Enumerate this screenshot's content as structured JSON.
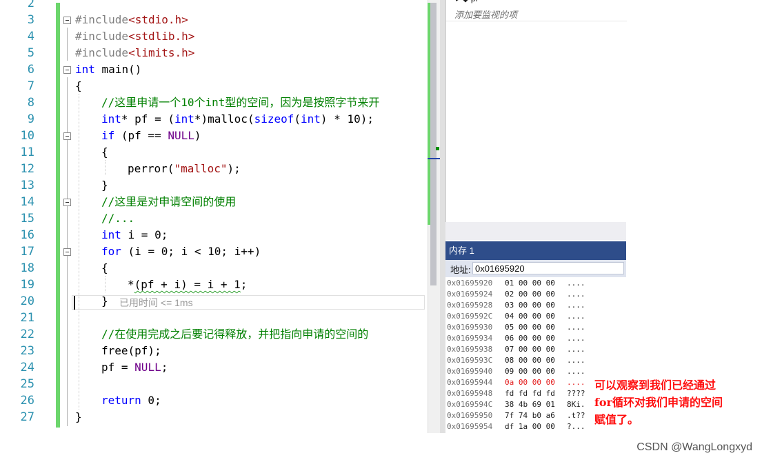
{
  "editor": {
    "lines": [
      {
        "n": "2",
        "indent": 0,
        "tokens": []
      },
      {
        "n": "3",
        "indent": 0,
        "tokens": [
          {
            "t": "#include",
            "c": "inc"
          },
          {
            "t": "<stdio.h>",
            "c": "str"
          }
        ]
      },
      {
        "n": "4",
        "indent": 0,
        "tokens": [
          {
            "t": "#include",
            "c": "inc"
          },
          {
            "t": "<stdlib.h>",
            "c": "str"
          }
        ]
      },
      {
        "n": "5",
        "indent": 0,
        "tokens": [
          {
            "t": "#include",
            "c": "inc"
          },
          {
            "t": "<limits.h>",
            "c": "str"
          }
        ]
      },
      {
        "n": "6",
        "indent": 0,
        "tokens": [
          {
            "t": "int",
            "c": "kw"
          },
          {
            "t": " main()",
            "c": ""
          }
        ]
      },
      {
        "n": "7",
        "indent": 0,
        "tokens": [
          {
            "t": "{",
            "c": ""
          }
        ]
      },
      {
        "n": "8",
        "indent": 1,
        "tokens": [
          {
            "t": "//这里申请一个10个int型的空间，因为是按照字节来开",
            "c": "cm"
          }
        ]
      },
      {
        "n": "9",
        "indent": 1,
        "tokens": [
          {
            "t": "int",
            "c": "kw"
          },
          {
            "t": "* pf = (",
            "c": ""
          },
          {
            "t": "int",
            "c": "kw"
          },
          {
            "t": "*)malloc(",
            "c": ""
          },
          {
            "t": "sizeof",
            "c": "kw"
          },
          {
            "t": "(",
            "c": ""
          },
          {
            "t": "int",
            "c": "kw"
          },
          {
            "t": ") * 10);",
            "c": ""
          }
        ]
      },
      {
        "n": "10",
        "indent": 1,
        "tokens": [
          {
            "t": "if",
            "c": "kw"
          },
          {
            "t": " (pf == ",
            "c": ""
          },
          {
            "t": "NULL",
            "c": "mac"
          },
          {
            "t": ")",
            "c": ""
          }
        ]
      },
      {
        "n": "11",
        "indent": 1,
        "tokens": [
          {
            "t": "{",
            "c": ""
          }
        ]
      },
      {
        "n": "12",
        "indent": 2,
        "tokens": [
          {
            "t": "perror(",
            "c": ""
          },
          {
            "t": "\"malloc\"",
            "c": "str"
          },
          {
            "t": ");",
            "c": ""
          }
        ]
      },
      {
        "n": "13",
        "indent": 1,
        "tokens": [
          {
            "t": "}",
            "c": ""
          }
        ]
      },
      {
        "n": "14",
        "indent": 1,
        "tokens": [
          {
            "t": "//这里是对申请空间的使用",
            "c": "cm"
          }
        ]
      },
      {
        "n": "15",
        "indent": 1,
        "tokens": [
          {
            "t": "//...",
            "c": "cm"
          }
        ]
      },
      {
        "n": "16",
        "indent": 1,
        "tokens": [
          {
            "t": "int",
            "c": "kw"
          },
          {
            "t": " i = 0;",
            "c": ""
          }
        ]
      },
      {
        "n": "17",
        "indent": 1,
        "tokens": [
          {
            "t": "for",
            "c": "kw"
          },
          {
            "t": " (i = 0; i < 10; i++)",
            "c": ""
          }
        ]
      },
      {
        "n": "18",
        "indent": 1,
        "tokens": [
          {
            "t": "{",
            "c": ""
          }
        ]
      },
      {
        "n": "19",
        "indent": 2,
        "tokens": [
          {
            "t": "*",
            "c": ""
          },
          {
            "t": "(pf + i) = i + 1",
            "c": "squig"
          },
          {
            "t": ";",
            "c": ""
          }
        ]
      },
      {
        "n": "20",
        "indent": 1,
        "tokens": [
          {
            "t": "}",
            "c": ""
          }
        ]
      },
      {
        "n": "21",
        "indent": 0,
        "tokens": []
      },
      {
        "n": "22",
        "indent": 1,
        "tokens": [
          {
            "t": "//在使用完成之后要记得释放，并把指向申请的空间的",
            "c": "cm"
          }
        ]
      },
      {
        "n": "23",
        "indent": 1,
        "tokens": [
          {
            "t": "free(pf);",
            "c": ""
          }
        ]
      },
      {
        "n": "24",
        "indent": 1,
        "tokens": [
          {
            "t": "pf = ",
            "c": ""
          },
          {
            "t": "NULL",
            "c": "mac"
          },
          {
            "t": ";",
            "c": ""
          }
        ]
      },
      {
        "n": "25",
        "indent": 0,
        "tokens": []
      },
      {
        "n": "26",
        "indent": 1,
        "tokens": [
          {
            "t": "return",
            "c": "kw"
          },
          {
            "t": " 0;",
            "c": ""
          }
        ]
      },
      {
        "n": "27",
        "indent": 0,
        "tokens": [
          {
            "t": "}",
            "c": ""
          }
        ]
      }
    ],
    "elapsed_hint": "已用时间 <= 1ms"
  },
  "watch": {
    "top_item": "pf",
    "add_placeholder": "添加要监视的项"
  },
  "memory": {
    "title": "内存 1",
    "address_label": "地址:",
    "address_value": "0x01695920",
    "rows": [
      {
        "addr": "0x01695920",
        "bytes": "01 00 00 00",
        "ascii": "....",
        "changed": false
      },
      {
        "addr": "0x01695924",
        "bytes": "02 00 00 00",
        "ascii": "....",
        "changed": false
      },
      {
        "addr": "0x01695928",
        "bytes": "03 00 00 00",
        "ascii": "....",
        "changed": false
      },
      {
        "addr": "0x0169592C",
        "bytes": "04 00 00 00",
        "ascii": "....",
        "changed": false
      },
      {
        "addr": "0x01695930",
        "bytes": "05 00 00 00",
        "ascii": "....",
        "changed": false
      },
      {
        "addr": "0x01695934",
        "bytes": "06 00 00 00",
        "ascii": "....",
        "changed": false
      },
      {
        "addr": "0x01695938",
        "bytes": "07 00 00 00",
        "ascii": "....",
        "changed": false
      },
      {
        "addr": "0x0169593C",
        "bytes": "08 00 00 00",
        "ascii": "....",
        "changed": false
      },
      {
        "addr": "0x01695940",
        "bytes": "09 00 00 00",
        "ascii": "....",
        "changed": false
      },
      {
        "addr": "0x01695944",
        "bytes": "0a 00 00 00",
        "ascii": "....",
        "changed": true
      },
      {
        "addr": "0x01695948",
        "bytes": "fd fd fd fd",
        "ascii": "????",
        "changed": false
      },
      {
        "addr": "0x0169594C",
        "bytes": "38 4b 69 01",
        "ascii": "8Ki.",
        "changed": false
      },
      {
        "addr": "0x01695950",
        "bytes": "7f 74 b0 a6",
        "ascii": ".t??",
        "changed": false
      },
      {
        "addr": "0x01695954",
        "bytes": "df 1a 00 00",
        "ascii": "?...",
        "changed": false
      }
    ]
  },
  "annotation": {
    "lines": [
      "可以观察到我们已经通过",
      "for循环对我们申请的空间",
      "赋值了。"
    ]
  },
  "watermark": "CSDN @WangLongxyd",
  "colors": {
    "keyword": "#0000ff",
    "comment": "#008000",
    "string": "#a31515",
    "macro": "#6f008a",
    "line_number": "#2b91af",
    "changed_bar": "#6cd66c",
    "memory_changed": "#e31919",
    "annotation": "#ff1010",
    "memory_title_bg": "#2e4d8a"
  }
}
